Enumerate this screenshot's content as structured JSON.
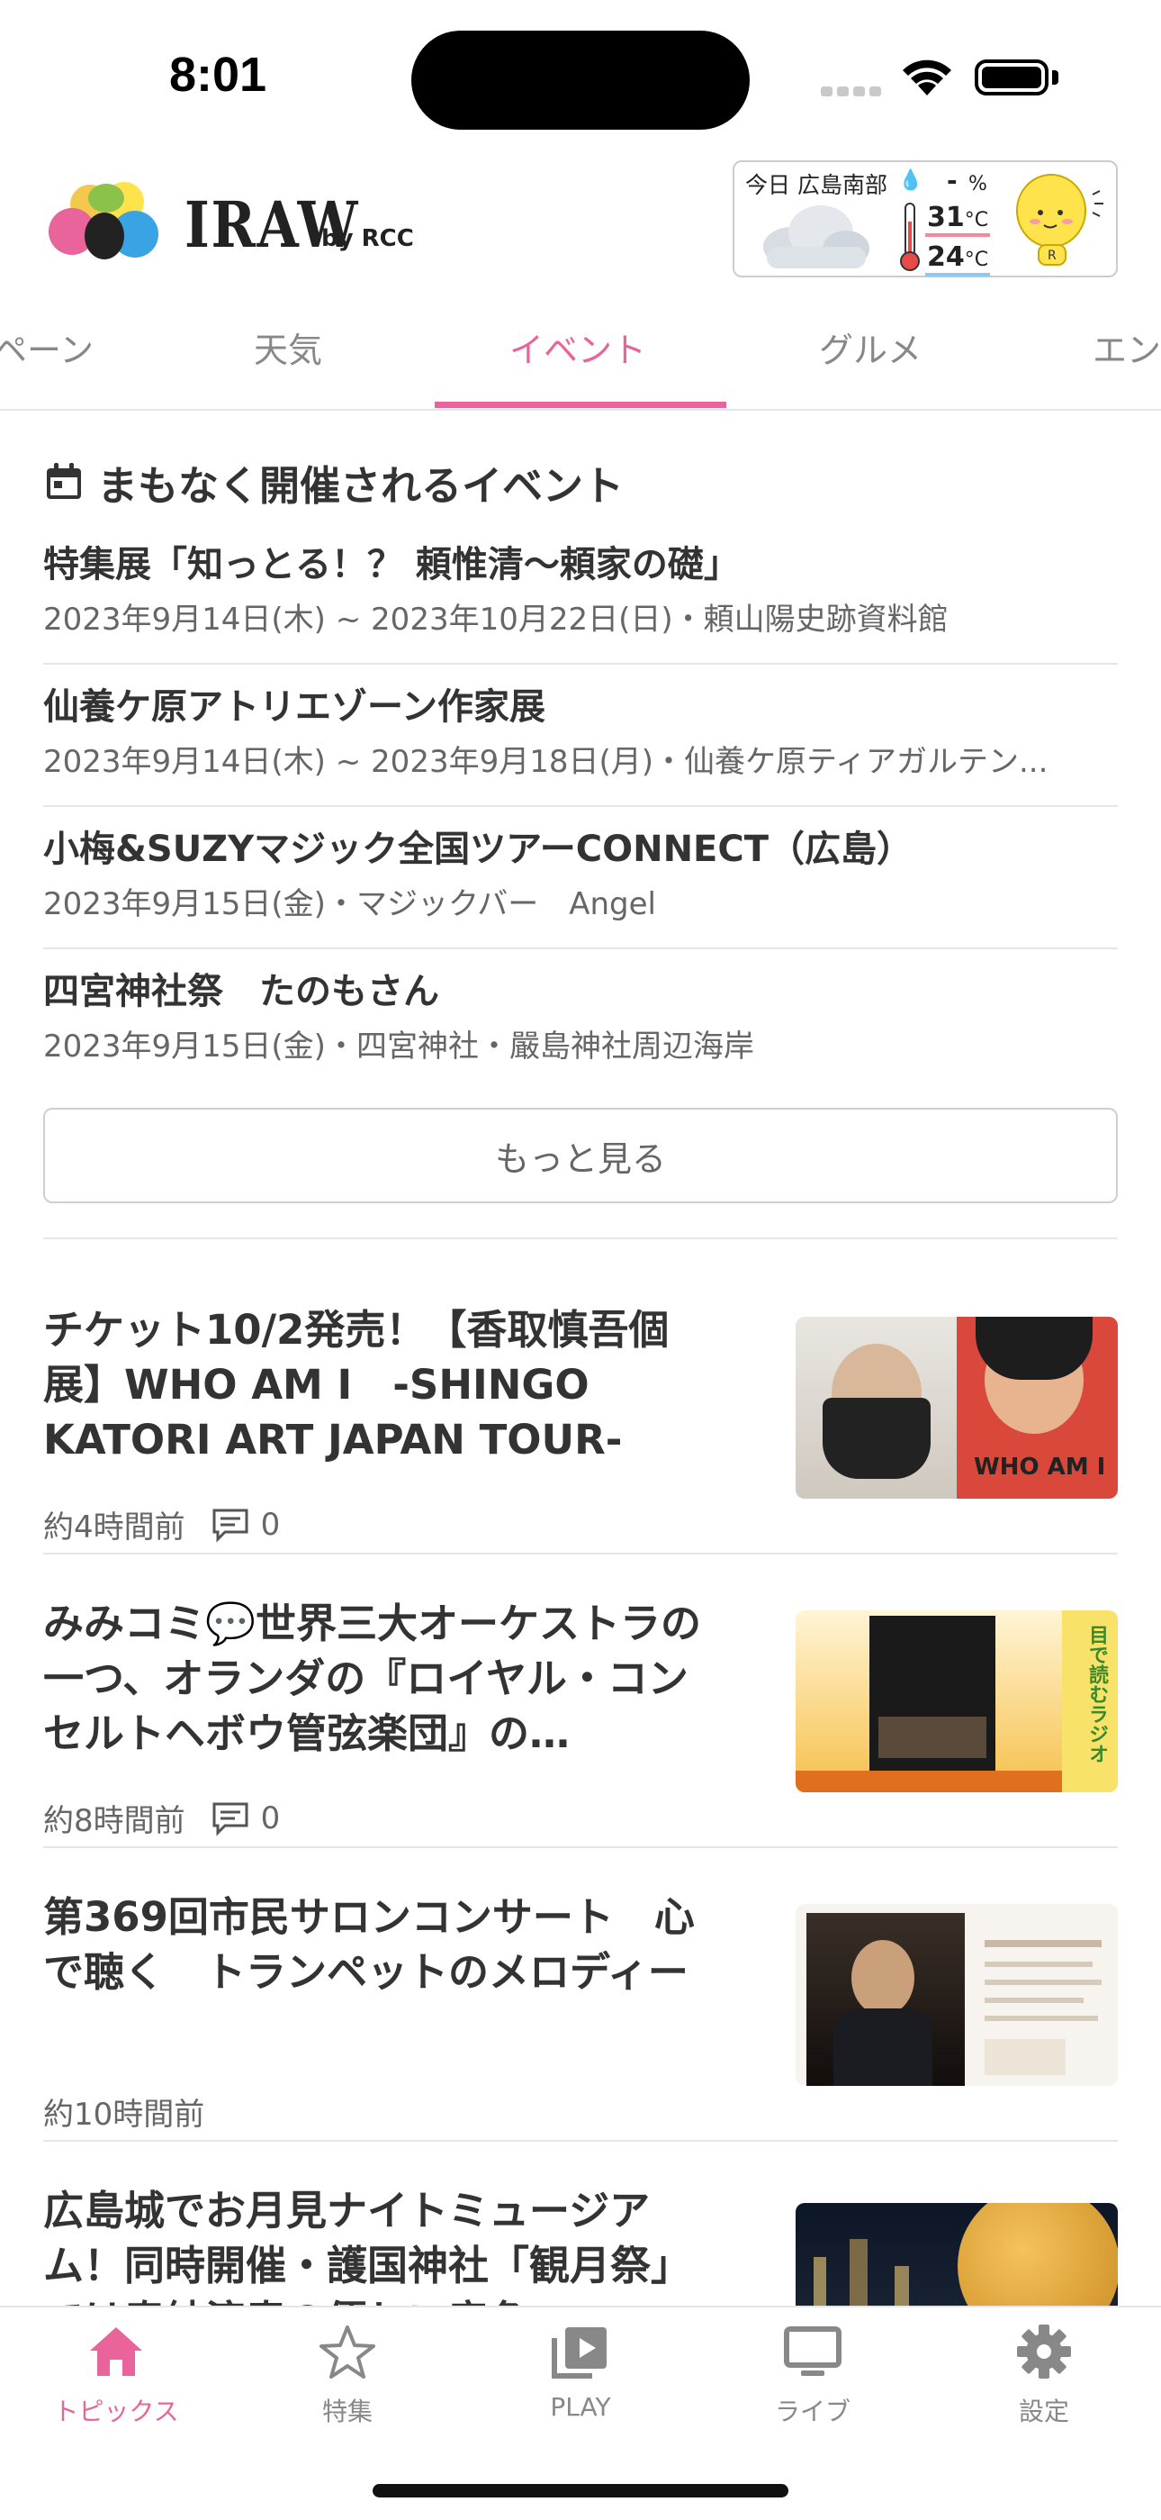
{
  "status": {
    "time": "8:01"
  },
  "header": {
    "logo_text": "IRAW",
    "logo_sub": "by RCC",
    "weather": {
      "label": "今日 広島南部",
      "rain_value": "-",
      "rain_unit": "%",
      "high": "31",
      "low": "24",
      "temp_unit": "°C"
    }
  },
  "tabs": [
    "ペーン",
    "天気",
    "イベント",
    "グルメ",
    "エン"
  ],
  "events": {
    "title": "まもなく開催されるイベント",
    "items": [
      {
        "title": "特集展「知っとる！？ 頼惟清～頼家の礎」",
        "sub": "2023年9月14日(木) ~ 2023年10月22日(日)・頼山陽史跡資料館"
      },
      {
        "title": "仙養ケ原アトリエゾーン作家展",
        "sub": "2023年9月14日(木) ~ 2023年9月18日(月)・仙養ケ原ティアガルテン..."
      },
      {
        "title": "小梅&SUZYマジック全国ツアーCONNECT（広島）",
        "sub": "2023年9月15日(金)・マジックバー　Angel"
      },
      {
        "title": "四宮神社祭　たのもさん",
        "sub": "2023年9月15日(金)・四宮神社・嚴島神社周辺海岸"
      }
    ],
    "more_label": "もっと見る"
  },
  "articles": [
    {
      "title": "チケット10/2発売！【香取慎吾個展】WHO AM I　-SHINGO KATORI ART JAPAN TOUR-",
      "time": "約4時間前",
      "comments": "0",
      "thumb_text": "WHO AM I"
    },
    {
      "title": "みみコミ💬世界三大オーケストラの一つ、オランダの『ロイヤル・コンセルトヘボウ管弦楽団』の…",
      "time": "約8時間前",
      "comments": "0",
      "thumb_text": "目で読むラジオ"
    },
    {
      "title": "第369回市民サロンコンサート　心で聴く　トランペットのメロディー",
      "time": "約10時間前",
      "thumb_text": ""
    },
    {
      "title": "広島城でお月見ナイトミュージアム！同時開催・護国神社「観月祭」では奉納演奏の優しい音色",
      "time": "",
      "thumb_text": ""
    }
  ],
  "tabbar": [
    {
      "label": "トピックス"
    },
    {
      "label": "特集"
    },
    {
      "label": "PLAY"
    },
    {
      "label": "ライブ"
    },
    {
      "label": "設定"
    }
  ],
  "colors": {
    "accent": "#e8649a"
  }
}
